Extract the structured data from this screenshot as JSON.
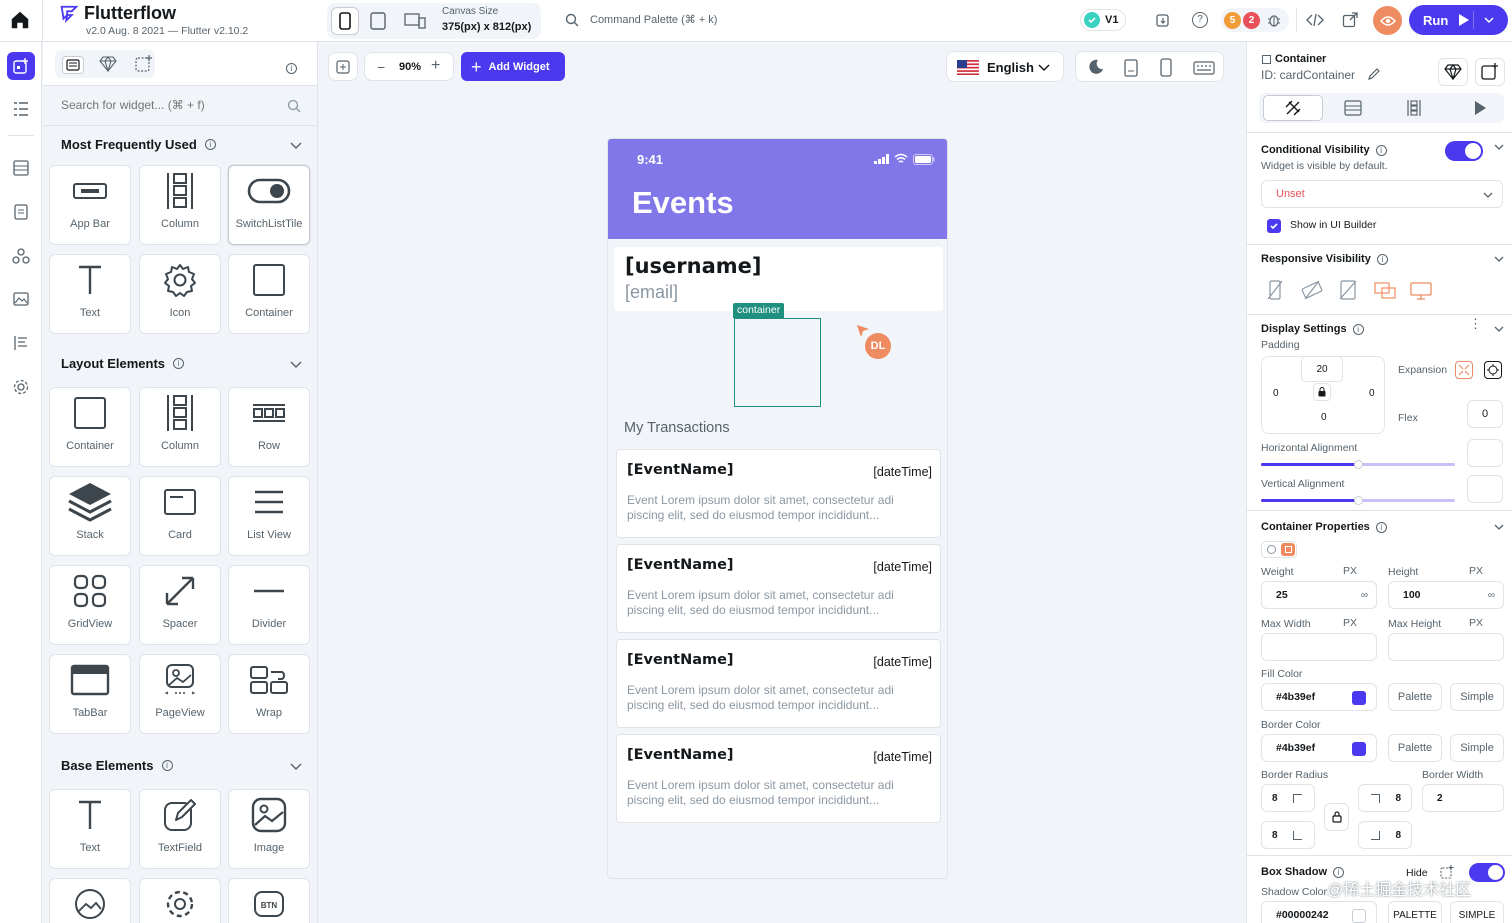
{
  "app": {
    "name": "Flutterflow",
    "version": "v2.0 Aug. 8 2021 — Flutter v2.10.2",
    "accent": "#4b39ef"
  },
  "topbar": {
    "canvas_size_label": "Canvas Size",
    "canvas_size_value": "375(px) x 812(px)",
    "command_palette": "Command Palette (⌘ + k)",
    "version_badge": "V1",
    "notif_a": "5",
    "notif_b": "2",
    "run_label": "Run"
  },
  "widget_panel": {
    "search_placeholder": "Search for widget... (⌘ + f)",
    "sections": {
      "frequent": "Most Frequently Used",
      "layout": "Layout Elements",
      "base": "Base Elements"
    },
    "frequent_items": [
      {
        "label": "App Bar",
        "icon": "app-bar-icon"
      },
      {
        "label": "Column",
        "icon": "column-icon"
      },
      {
        "label": "SwitchListTile",
        "icon": "switch-icon"
      },
      {
        "label": "Text",
        "icon": "text-icon"
      },
      {
        "label": "Icon",
        "icon": "gear-icon"
      },
      {
        "label": "Container",
        "icon": "container-icon"
      }
    ],
    "layout_items": [
      {
        "label": "Container",
        "icon": "container-icon"
      },
      {
        "label": "Column",
        "icon": "column-icon"
      },
      {
        "label": "Row",
        "icon": "row-icon"
      },
      {
        "label": "Stack",
        "icon": "stack-icon"
      },
      {
        "label": "Card",
        "icon": "card-icon"
      },
      {
        "label": "List View",
        "icon": "list-view-icon"
      },
      {
        "label": "GridView",
        "icon": "grid-view-icon"
      },
      {
        "label": "Spacer",
        "icon": "spacer-icon"
      },
      {
        "label": "Divider",
        "icon": "divider-icon"
      },
      {
        "label": "TabBar",
        "icon": "tab-bar-icon"
      },
      {
        "label": "PageView",
        "icon": "page-view-icon"
      },
      {
        "label": "Wrap",
        "icon": "wrap-icon"
      }
    ],
    "base_items": [
      {
        "label": "Text",
        "icon": "text-icon"
      },
      {
        "label": "TextField",
        "icon": "text-field-icon"
      },
      {
        "label": "Image",
        "icon": "image-icon"
      }
    ]
  },
  "canvas": {
    "zoom": "90%",
    "add_widget": "Add Widget",
    "language": "English"
  },
  "phone": {
    "time": "9:41",
    "title": "Events",
    "header_color": "#8277e8",
    "username": "[username]",
    "email": "[email]",
    "container_tag": "container",
    "cursor_initials": "DL",
    "section_label": "My Transactions",
    "events": [
      {
        "name": "[EventName]",
        "date": "[dateTime]",
        "desc": "Event Lorem ipsum dolor sit amet, consectetur adi piscing elit, sed do eiusmod tempor incididunt..."
      },
      {
        "name": "[EventName]",
        "date": "[dateTime]",
        "desc": "Event Lorem ipsum dolor sit amet, consectetur adi piscing elit, sed do eiusmod tempor incididunt..."
      },
      {
        "name": "[EventName]",
        "date": "[dateTime]",
        "desc": "Event Lorem ipsum dolor sit amet, consectetur adi piscing elit, sed do eiusmod tempor incididunt..."
      },
      {
        "name": "[EventName]",
        "date": "[dateTime]",
        "desc": "Event Lorem ipsum dolor sit amet, consectetur adi piscing elit, sed do eiusmod tempor incididunt..."
      }
    ]
  },
  "props": {
    "widget_type": "Container",
    "widget_id": "ID: cardContainer",
    "conditional": {
      "title": "Conditional Visibility",
      "desc": "Widget is visible by default.",
      "select": "Unset",
      "show_in_builder": "Show in UI Builder"
    },
    "responsive": {
      "title": "Responsive Visibility"
    },
    "display": {
      "title": "Display Settings",
      "padding_label": "Padding",
      "pad_top": "20",
      "pad_left": "0",
      "pad_right": "0",
      "pad_bottom": "0",
      "expansion": "Expansion",
      "flex": "Flex",
      "flex_value": "0",
      "h_align": "Horizontal Alignment",
      "v_align": "Vertical Alignment",
      "h_align_pos": 0.5,
      "v_align_pos": 0.5
    },
    "container": {
      "title": "Container Properties",
      "weight": "Weight",
      "weight_value": "25",
      "height": "Height",
      "height_value": "100",
      "px": "PX",
      "inf": "∞",
      "max_width": "Max Width",
      "max_height": "Max Height",
      "fill_color": "Fill Color",
      "fill_value": "#4b39ef",
      "border_color": "Border Color",
      "border_value": "#4b39ef",
      "palette": "Palette",
      "simple": "Simple",
      "border_radius": "Border Radius",
      "border_width": "Border Width",
      "radius_tl": "8",
      "radius_tr": "8",
      "radius_bl": "8",
      "radius_br": "8",
      "border_width_value": "2"
    },
    "shadow": {
      "title": "Box Shadow",
      "hide": "Hide",
      "shadow_color": "Shadow Color",
      "shadow_value": "#00000242",
      "palette": "PALETTE",
      "simple": "SIMPLE"
    },
    "watermark": "@稀土掘金技术社区"
  }
}
